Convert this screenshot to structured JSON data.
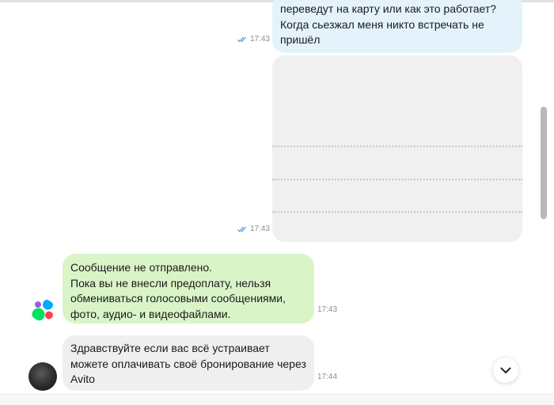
{
  "messages": {
    "outgoing_text": {
      "lines": [
        "переведут на карту или как это работает?",
        "Когда сьезжал меня никто встречать не",
        "пришёл"
      ],
      "time": "17:43",
      "status": "read"
    },
    "outgoing_image": {
      "time": "17:43",
      "status": "read"
    },
    "system_notice": {
      "lines": [
        "Сообщение не отправлено.",
        "Пока вы не внесли предоплату, нельзя",
        "обмениваться голосовыми сообщениями,",
        "фото, аудио- и видеофайлами."
      ],
      "time": "17:43"
    },
    "incoming_text": {
      "lines": [
        "Здравствуйте если вас всё устраивает",
        "можете оплачивать своё бронирование через",
        "Avito"
      ],
      "time": "17:44"
    }
  },
  "colors": {
    "outgoing_bubble": "#e4f3fb",
    "system_bubble": "#d9f5c8",
    "incoming_bubble": "#efefef",
    "read_check": "#4a90e2",
    "avito_blue": "#00aaff",
    "avito_purple": "#965eeb",
    "avito_green": "#04e061",
    "avito_red": "#ff4053"
  },
  "icons": {
    "read_status": "double-check-icon",
    "scroll_down": "chevron-down-icon",
    "avito_logo": "avito-logo-icon"
  }
}
